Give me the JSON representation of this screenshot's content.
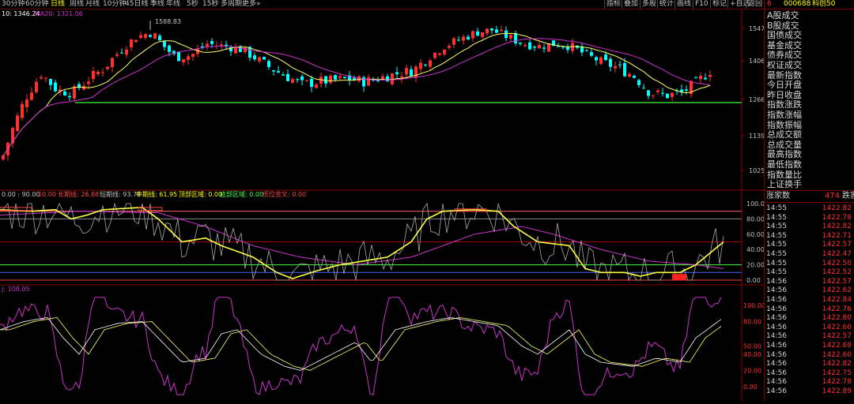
{
  "toolbar": {
    "periods": [
      {
        "label": "30分钟",
        "active": false
      },
      {
        "label": "60分钟",
        "active": false
      },
      {
        "label": "日线",
        "active": true
      },
      {
        "label": "周线",
        "active": false
      },
      {
        "label": "月线",
        "active": false
      },
      {
        "label": "10分钟",
        "active": false
      },
      {
        "label": "45日线",
        "active": false
      },
      {
        "label": "季线",
        "active": false
      },
      {
        "label": "年线",
        "active": false
      },
      {
        "label": "5秒",
        "active": false
      },
      {
        "label": "15秒",
        "active": false
      },
      {
        "label": "多周期",
        "active": false
      },
      {
        "label": "更多»",
        "active": false
      }
    ],
    "tools": [
      "指标",
      "叠加",
      "多股",
      "统计",
      "画线",
      "F10",
      "标记",
      "+自选",
      "返回"
    ]
  },
  "main_chart": {
    "legend_ma10": "10: 1346.24",
    "legend_ma20": "MA20: 1321.06",
    "peak_label": "1588.83",
    "price_axis": [
      "1547",
      "1406",
      "1266",
      "1139",
      "1025"
    ],
    "support_level": 1266,
    "colors": {
      "up": "#ff3030",
      "down": "#00ffff",
      "ma10": "#ffff66",
      "ma20": "#cc33cc",
      "support": "#44ff44"
    }
  },
  "indicator1": {
    "legend": [
      {
        "text": "0.00 : 90.00",
        "color": "#c0c0c0"
      },
      {
        "text": "50.00",
        "color": "#ff4444"
      },
      {
        "text": "长期线: 26.68",
        "color": "#ff4444"
      },
      {
        "text": "短期线: 93.78",
        "color": "#c0c0c0"
      },
      {
        "text": "中期线: 61.95",
        "color": "#ffff00"
      },
      {
        "text": "顶部区域: 0.00",
        "color": "#ffff00"
      },
      {
        "text": "底部区域: 0.00",
        "color": "#44ff44"
      },
      {
        "text": "低位金叉: 0.00",
        "color": "#ff4444"
      }
    ],
    "axis": [
      "100.0",
      "80.00",
      "60.00",
      "40.00",
      "20.00",
      "0.00"
    ]
  },
  "indicator2": {
    "legend": "J: 108.05",
    "axis": [
      "100.00",
      "80.00",
      "50.00",
      "40.00",
      "20.00",
      "0.00"
    ]
  },
  "quote": {
    "code": "000688",
    "name": "科创50",
    "tag": "6",
    "menu": [
      "A股成交",
      "B股成交",
      "国债成交",
      "基金成交",
      "债券成交",
      "权证成交",
      "最新指数",
      "今日开盘",
      "昨日收盘",
      "指数涨跌",
      "指数涨幅",
      "指数振幅",
      "总成交额",
      "总成交量",
      "最高指数",
      "最低指数",
      "指数量比",
      "上证换手"
    ],
    "breadth_up_label": "涨家数",
    "breadth_count": "474",
    "breadth_down_label": "跌家数",
    "ticks": [
      {
        "time": "14:55",
        "price": "1422.82"
      },
      {
        "time": "14:55",
        "price": "1422.78"
      },
      {
        "time": "14:55",
        "price": "1422.82"
      },
      {
        "time": "14:55",
        "price": "1422.71"
      },
      {
        "time": "14:55",
        "price": "1422.57"
      },
      {
        "time": "14:55",
        "price": "1422.47"
      },
      {
        "time": "14:55",
        "price": "1422.50"
      },
      {
        "time": "14:55",
        "price": "1422.52"
      },
      {
        "time": "14:56",
        "price": "1422.57"
      },
      {
        "time": "14:56",
        "price": "1422.62"
      },
      {
        "time": "14:56",
        "price": "1422.84"
      },
      {
        "time": "14:56",
        "price": "1422.76"
      },
      {
        "time": "14:56",
        "price": "1422.80"
      },
      {
        "time": "14:56",
        "price": "1422.60"
      },
      {
        "time": "14:56",
        "price": "1422.57"
      },
      {
        "time": "14:56",
        "price": "1422.69"
      },
      {
        "time": "14:56",
        "price": "1422.60"
      },
      {
        "time": "14:56",
        "price": "1422.82"
      },
      {
        "time": "14:56",
        "price": "1422.75"
      },
      {
        "time": "14:56",
        "price": "1422.78"
      },
      {
        "time": "14:56",
        "price": "1422.89"
      }
    ]
  }
}
